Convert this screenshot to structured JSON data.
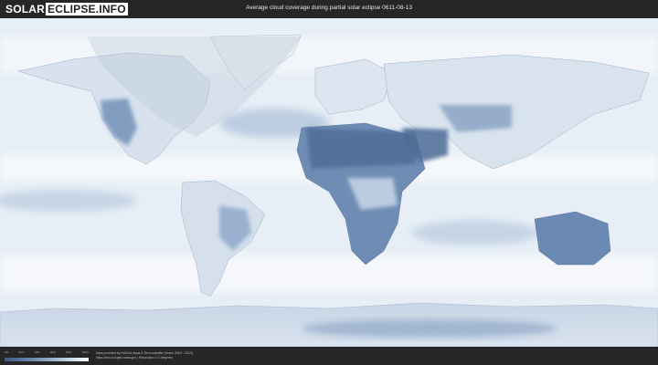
{
  "header": {
    "logo_part1": "SOLAR",
    "logo_part2": "ECLIPSE.INFO",
    "title": "Average cloud coverage during partial solar eclipse 0611-08-13"
  },
  "legend": {
    "ticks": [
      "0%",
      "20%",
      "40%",
      "60%",
      "80%",
      "100%"
    ],
    "colors": {
      "clear": "#3d5a80",
      "cloudy": "#ffffff"
    }
  },
  "footer": {
    "credit_line1": "Data provided by NASA's Aqua & Terra satellite (Years: 2003 - 2019)",
    "credit_line2": "https://neo.sci.gsfc.nasa.gov | Resolution: 0.1 degrees"
  },
  "colors": {
    "header_bg": "#262626",
    "ocean_light": "#ffffff",
    "land_clear": "#5a79a3"
  }
}
